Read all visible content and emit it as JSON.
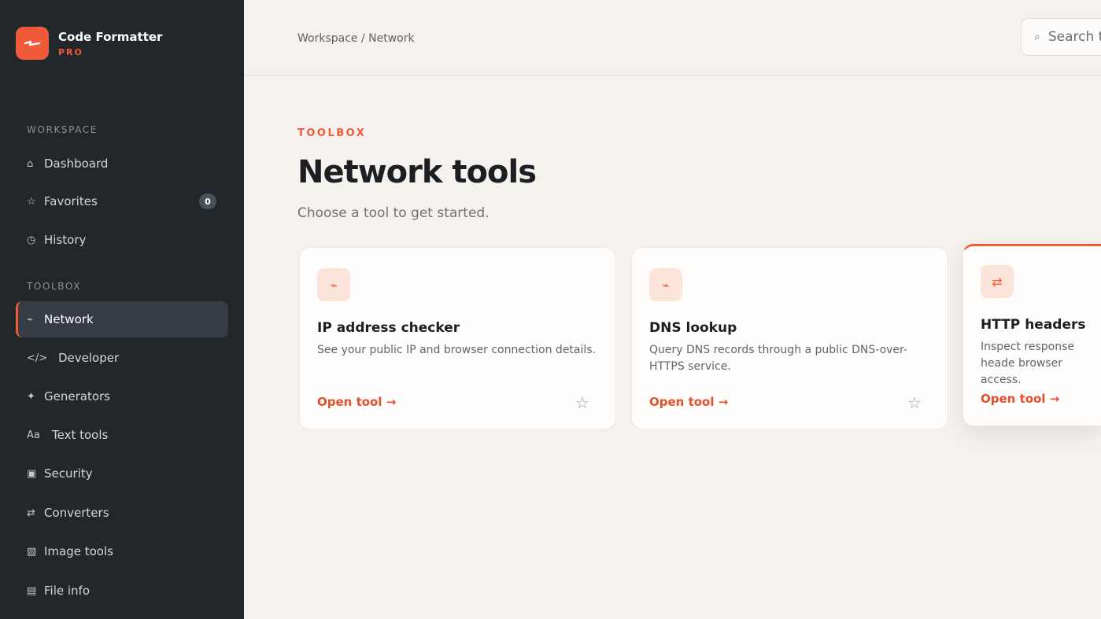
{
  "brand": {
    "name": "Code Formatter",
    "tier": "PRO",
    "accent": "#f05a38"
  },
  "sidebar": {
    "sections": [
      {
        "label": "WORKSPACE"
      },
      {
        "label": "TOOLBOX"
      }
    ],
    "workspace_items": [
      {
        "icon": "home-icon",
        "glyph": "⌂",
        "label": "Dashboard"
      },
      {
        "icon": "star-icon",
        "glyph": "☆",
        "label": "Favorites",
        "badge": "0"
      },
      {
        "icon": "clock-icon",
        "glyph": "◷",
        "label": "History"
      }
    ],
    "toolbox_items": [
      {
        "icon": "network-icon",
        "glyph": "⌁",
        "label": "Network",
        "active": true
      },
      {
        "icon": "code-icon",
        "glyph": "</>",
        "label": "Developer"
      },
      {
        "icon": "sparkle-icon",
        "glyph": "✦",
        "label": "Generators"
      },
      {
        "icon": "text-icon",
        "glyph": "Aa",
        "label": "Text tools"
      },
      {
        "icon": "shield-icon",
        "glyph": "▣",
        "label": "Security"
      },
      {
        "icon": "arrows-icon",
        "glyph": "⇄",
        "label": "Converters"
      },
      {
        "icon": "image-icon",
        "glyph": "▧",
        "label": "Image tools"
      },
      {
        "icon": "file-icon",
        "glyph": "▤",
        "label": "File info"
      }
    ]
  },
  "header": {
    "breadcrumb": "Workspace / Network",
    "search_placeholder": "Search t",
    "search_icon": "search-icon"
  },
  "main": {
    "eyebrow": "TOOLBOX",
    "title": "Network tools",
    "subtitle": "Choose a tool to get started.",
    "cards": [
      {
        "icon": "network-icon",
        "glyph": "⌁",
        "title": "IP address checker",
        "description": "See your public IP and browser connection details.",
        "link": "Open tool →"
      },
      {
        "icon": "network-icon",
        "glyph": "⌁",
        "title": "DNS lookup",
        "description": "Query DNS records through a public DNS-over-HTTPS service.",
        "link": "Open tool →"
      },
      {
        "icon": "arrows-icon",
        "glyph": "⇄",
        "title": "HTTP headers",
        "description": "Inspect response heade browser access.",
        "link": "Open tool →"
      }
    ]
  }
}
